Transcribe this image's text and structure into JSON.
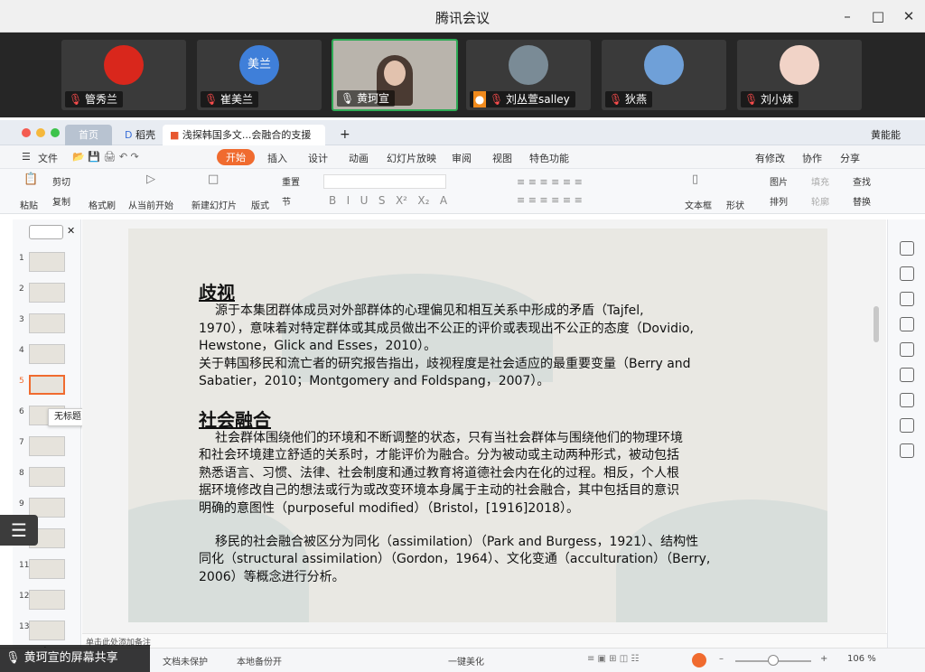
{
  "window": {
    "title": "腾讯会议"
  },
  "participants": [
    {
      "name": "管秀兰",
      "avatar_text": "",
      "avatar_color": "#d9271c",
      "muted": true
    },
    {
      "name": "崔美兰",
      "avatar_text": "美兰",
      "avatar_color": "#3f7fd9",
      "muted": true
    },
    {
      "name": "黄珂宣",
      "avatar_text": "",
      "avatar_color": "#b9b4ac",
      "muted": false
    },
    {
      "name": "刘丛萱salley",
      "avatar_text": "",
      "avatar_color": "#7a8b96",
      "muted": true
    },
    {
      "name": "狄燕",
      "avatar_text": "",
      "avatar_color": "#6fa0d8",
      "muted": true
    },
    {
      "name": "刘小妹",
      "avatar_text": "",
      "avatar_color": "#f1d3c7",
      "muted": true
    }
  ],
  "wps": {
    "tabs": {
      "home": "首页",
      "docer": "稻壳",
      "doc": "浅探韩国多文...会融合的支援",
      "add": "+",
      "user": "黄能能"
    },
    "menu": {
      "file": "文件",
      "start": "开始",
      "insert": "插入",
      "design": "设计",
      "animation": "动画",
      "slideshow": "幻灯片放映",
      "review": "审阅",
      "view": "视图",
      "features": "特色功能",
      "changes": "有修改",
      "collab": "协作",
      "share": "分享"
    },
    "ribbon": {
      "paste": "粘贴",
      "cut": "剪切",
      "copy": "复制",
      "format_painter": "格式刷",
      "from_current": "从当前开始",
      "new_slide": "新建幻灯片",
      "layout": "版式",
      "section": "节",
      "reset": "重置",
      "textbox": "文本框",
      "shape": "形状",
      "picture": "图片",
      "arrange": "排列",
      "fill": "填充",
      "outline": "轮廓",
      "find": "查找",
      "replace": "替换"
    },
    "thumbs": [
      "1",
      "2",
      "3",
      "4",
      "5",
      "6",
      "7",
      "8",
      "9",
      "10",
      "11",
      "12",
      "13"
    ],
    "tooltip": "无标题",
    "slide": {
      "h1": "歧视",
      "p1": [
        "源于本集团群体成员对外部群体的心理偏见和相互关系中形成的矛盾（Tajfel,",
        "1970），意味着对特定群体或其成员做出不公正的评价或表现出不公正的态度（Dovidio,",
        "Hewstone，Glick and Esses，2010）。",
        "关于韩国移民和流亡者的研究报告指出，歧视程度是社会适应的最重要变量（Berry and",
        "Sabatier，2010；Montgomery and Foldspang，2007）。"
      ],
      "h2": "社会融合",
      "p2": [
        "社会群体围绕他们的环境和不断调整的状态，只有当社会群体与围绕他们的物理环境",
        "和社会环境建立舒适的关系时，才能评价为融合。分为被动或主动两种形式，被动包括",
        "熟悉语言、习惯、法律、社会制度和通过教育将道德社会内在化的过程。相反，个人根",
        "据环境修改自己的想法或行为或改变环境本身属于主动的社会融合，其中包括目的意识",
        "明确的意图性（purposeful modified）（Bristol，[1916]2018）。"
      ],
      "p3": [
        "移民的社会融合被区分为同化（assimilation）（Park and Burgess，1921）、结构性",
        "同化（structural assimilation）（Gordon，1964）、文化变通（acculturation）（Berry,",
        "2006）等概念进行分析。"
      ]
    },
    "status": {
      "notes": "单击此处添加备注",
      "unprotected": "文档未保护",
      "backup": "本地备份开",
      "beautify": "一键美化",
      "zoom": "106 %"
    }
  },
  "share_label": "黄珂宣的屏幕共享"
}
